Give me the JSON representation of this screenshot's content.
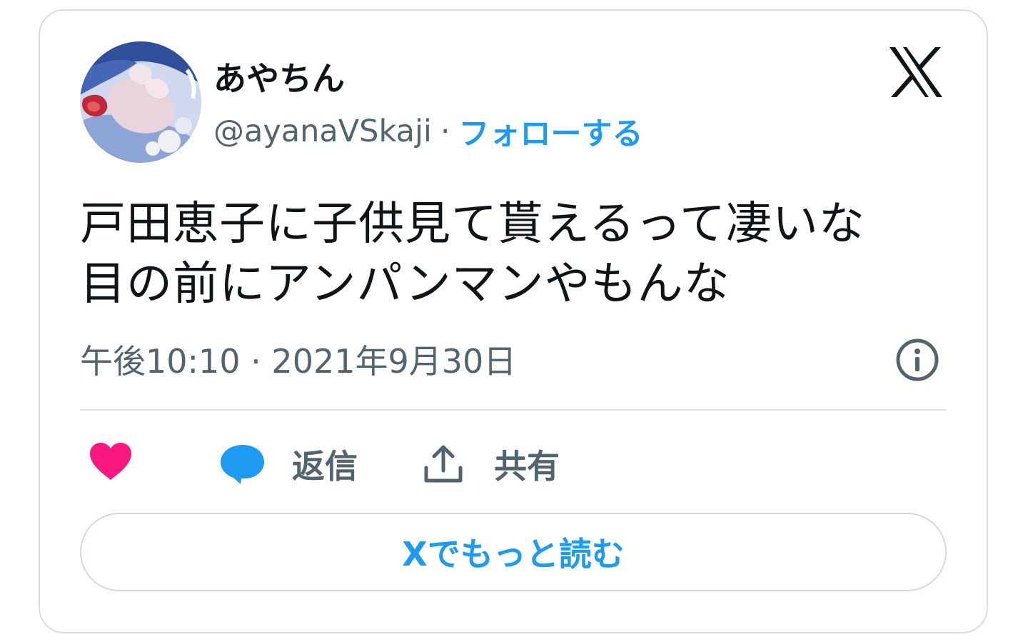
{
  "author": {
    "name": "あやちん",
    "handle": "@ayanaVSkaji",
    "separator": "·",
    "follow_label": "フォローする"
  },
  "tweet": {
    "lines": [
      "戸田恵子に子供見て貰えるって凄いな",
      "目の前にアンパンマンやもんな"
    ],
    "timestamp": "午後10:10 · 2021年9月30日"
  },
  "actions": {
    "like_icon": "heart-icon",
    "reply_label": "返信",
    "share_label": "共有"
  },
  "read_more_label": "Xでもっと読む",
  "colors": {
    "accent": "#1d9bf0",
    "like": "#f91880",
    "secondary_text": "#536471",
    "primary_text": "#0f1419",
    "border": "#d9dde0"
  }
}
